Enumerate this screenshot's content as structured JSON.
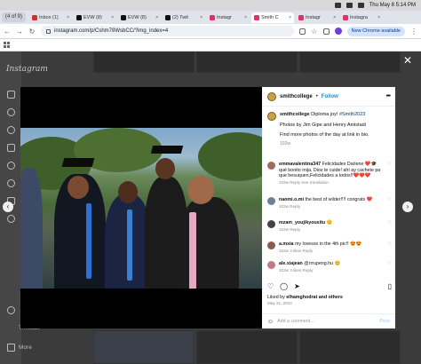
{
  "menubar": {
    "datetime": "Thu May 8  5:14 PM"
  },
  "window": {
    "counter": "(4 of 9)"
  },
  "tabs": [
    {
      "label": "Inbox (1)",
      "color": "#d93025",
      "active": false
    },
    {
      "label": "EVW (8)",
      "color": "#111111",
      "active": false
    },
    {
      "label": "EVW (8)",
      "color": "#111111",
      "active": false
    },
    {
      "label": "(2) Twit",
      "color": "#111111",
      "active": false
    },
    {
      "label": "Instagr",
      "color": "#e1306c",
      "active": false
    },
    {
      "label": "Smith C",
      "color": "#e1306c",
      "active": true
    },
    {
      "label": "Instagr",
      "color": "#e1306c",
      "active": false
    },
    {
      "label": "Instagra",
      "color": "#e1306c",
      "active": false
    }
  ],
  "address": {
    "url": "instagram.com/p/Cshm78WsbCC/?img_index=4",
    "new_chrome": "New Chrome available"
  },
  "sidebar": {
    "logo": "Instagram",
    "bottom_items": [
      {
        "label": "Threads"
      },
      {
        "label": "More"
      }
    ]
  },
  "post": {
    "username": "smithcollege",
    "follow": "Follow",
    "caption_title": "Diploma joy!",
    "caption_tag": "#Smith2023",
    "caption_photos": "Photos by Jim Gipe and Henry Amistadi",
    "caption_more": "Find more photos of the day at link in bio.",
    "caption_time": "102w",
    "likes_prefix": "Liked by ",
    "likes_user": "elhamghodrat",
    "likes_suffix": " and others",
    "date": "May 21, 2023",
    "add_comment": "Add a comment...",
    "post_btn": "Post"
  },
  "comments": [
    {
      "user": "emmavalentina347",
      "text": "Felicidades Darlene ❤️🎓 qué bonito mija, Dios te cuide! ahí ay cachete pa que besuquen,Felicidades a todos!!❤️❤️❤️",
      "meta": "102w   Reply   See translation",
      "avatar": "#a36b5a"
    },
    {
      "user": "naomi.o.mi",
      "text": "the best of wilder!!!! congrats ❤️",
      "meta": "102w   Reply",
      "avatar": "#6f7f96"
    },
    {
      "user": "mzam_youjikyousitu",
      "text": "😊",
      "meta": "102w   Reply",
      "avatar": "#444444"
    },
    {
      "user": "a.mxia",
      "text": "my lovesss in the 4th pic!! 😍😍",
      "meta": "102w   3 likes   Reply",
      "avatar": "#8a5c4a"
    },
    {
      "user": "ale.xiajean",
      "text": "@rrrupeng.hu 😊",
      "meta": "102w   3 likes   Reply",
      "avatar": "#c27b84"
    }
  ]
}
